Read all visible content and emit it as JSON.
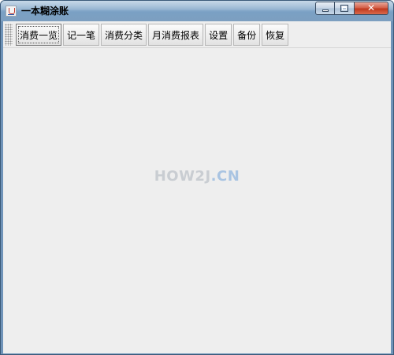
{
  "window": {
    "title": "一本糊涂账",
    "controls": {
      "minimize_icon": "minimize-icon",
      "maximize_icon": "maximize-icon",
      "close_icon": "close-icon",
      "close_glyph": "✕"
    },
    "app_icon": "java-cup-icon"
  },
  "toolbar": {
    "buttons": [
      {
        "label": "消费一览",
        "active": true
      },
      {
        "label": "记一笔"
      },
      {
        "label": "消费分类"
      },
      {
        "label": "月消费报表"
      },
      {
        "label": "设置"
      },
      {
        "label": "备份"
      },
      {
        "label": "恢复"
      }
    ]
  },
  "watermark": {
    "main": "HOW2J",
    "dot": ".",
    "accent": "CN"
  },
  "colors": {
    "titlebar": "#7aa0c4",
    "client_background": "#eeeeee",
    "close_button": "#c0391e",
    "watermark_gray": "#c9cdd2",
    "watermark_blue": "#a9c4e2"
  }
}
